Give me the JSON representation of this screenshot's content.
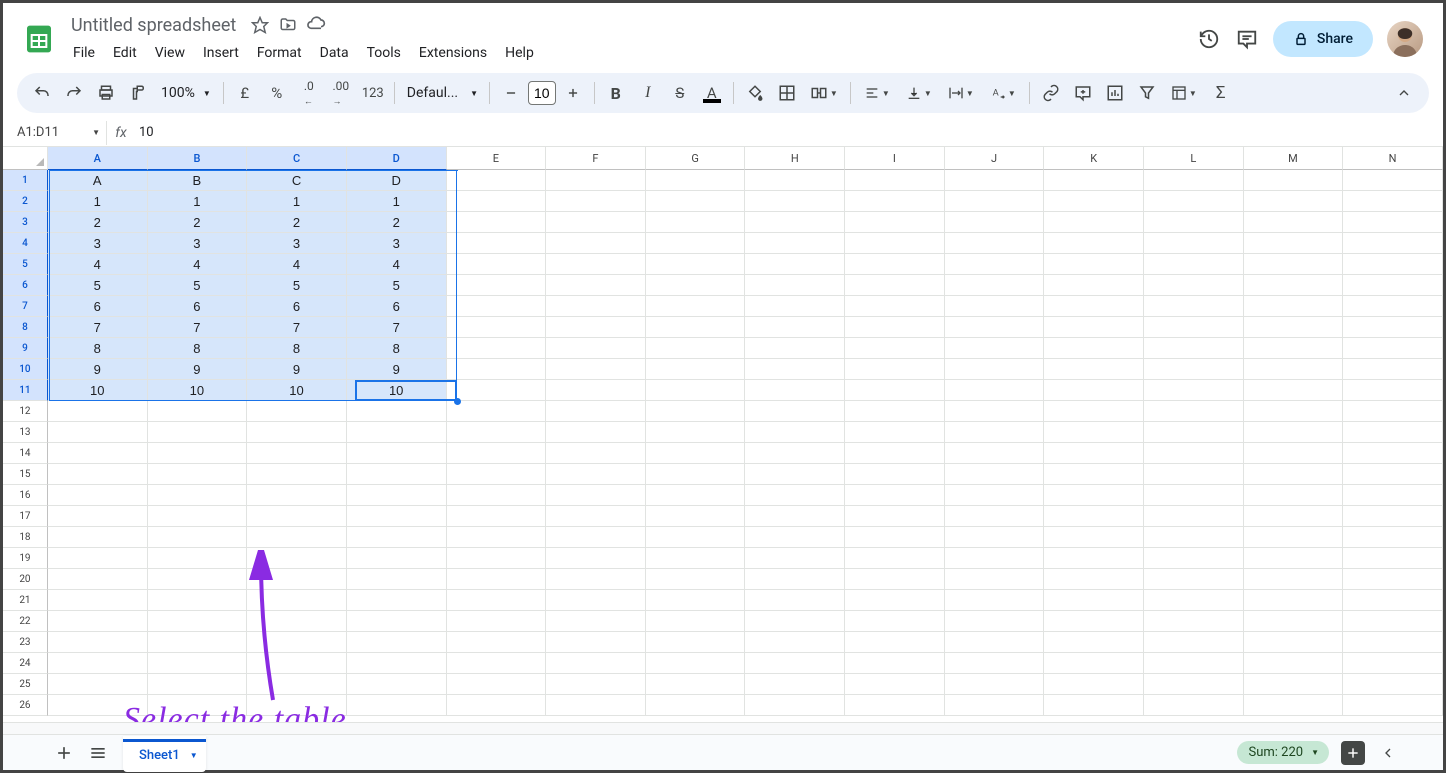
{
  "app": {
    "doc_title": "Untitled spreadsheet",
    "share_label": "Share"
  },
  "menubar": [
    "File",
    "Edit",
    "View",
    "Insert",
    "Format",
    "Data",
    "Tools",
    "Extensions",
    "Help"
  ],
  "toolbar": {
    "zoom": "100%",
    "font_name": "Defaul...",
    "font_size": "10",
    "currency_symbol": "£",
    "percent_symbol": "%",
    "number_format": "123"
  },
  "name_box": "A1:D11",
  "formula": "10",
  "columns": [
    "A",
    "B",
    "C",
    "D",
    "E",
    "F",
    "G",
    "H",
    "I",
    "J",
    "K",
    "L",
    "M",
    "N"
  ],
  "selected_cols": [
    "A",
    "B",
    "C",
    "D"
  ],
  "rows": [
    1,
    2,
    3,
    4,
    5,
    6,
    7,
    8,
    9,
    10,
    11,
    12,
    13,
    14,
    15,
    16,
    17,
    18,
    19,
    20,
    21,
    22,
    23,
    24,
    25,
    26
  ],
  "selected_rows": [
    1,
    2,
    3,
    4,
    5,
    6,
    7,
    8,
    9,
    10,
    11
  ],
  "cells": {
    "1": {
      "A": "A",
      "B": "B",
      "C": "C",
      "D": "D"
    },
    "2": {
      "A": "1",
      "B": "1",
      "C": "1",
      "D": "1"
    },
    "3": {
      "A": "2",
      "B": "2",
      "C": "2",
      "D": "2"
    },
    "4": {
      "A": "3",
      "B": "3",
      "C": "3",
      "D": "3"
    },
    "5": {
      "A": "4",
      "B": "4",
      "C": "4",
      "D": "4"
    },
    "6": {
      "A": "5",
      "B": "5",
      "C": "5",
      "D": "5"
    },
    "7": {
      "A": "6",
      "B": "6",
      "C": "6",
      "D": "6"
    },
    "8": {
      "A": "7",
      "B": "7",
      "C": "7",
      "D": "7"
    },
    "9": {
      "A": "8",
      "B": "8",
      "C": "8",
      "D": "8"
    },
    "10": {
      "A": "9",
      "B": "9",
      "C": "9",
      "D": "9"
    },
    "11": {
      "A": "10",
      "B": "10",
      "C": "10",
      "D": "10"
    }
  },
  "sheet_tab": "Sheet1",
  "status": {
    "sum_label": "Sum: 220"
  },
  "annotation": "Select the table"
}
